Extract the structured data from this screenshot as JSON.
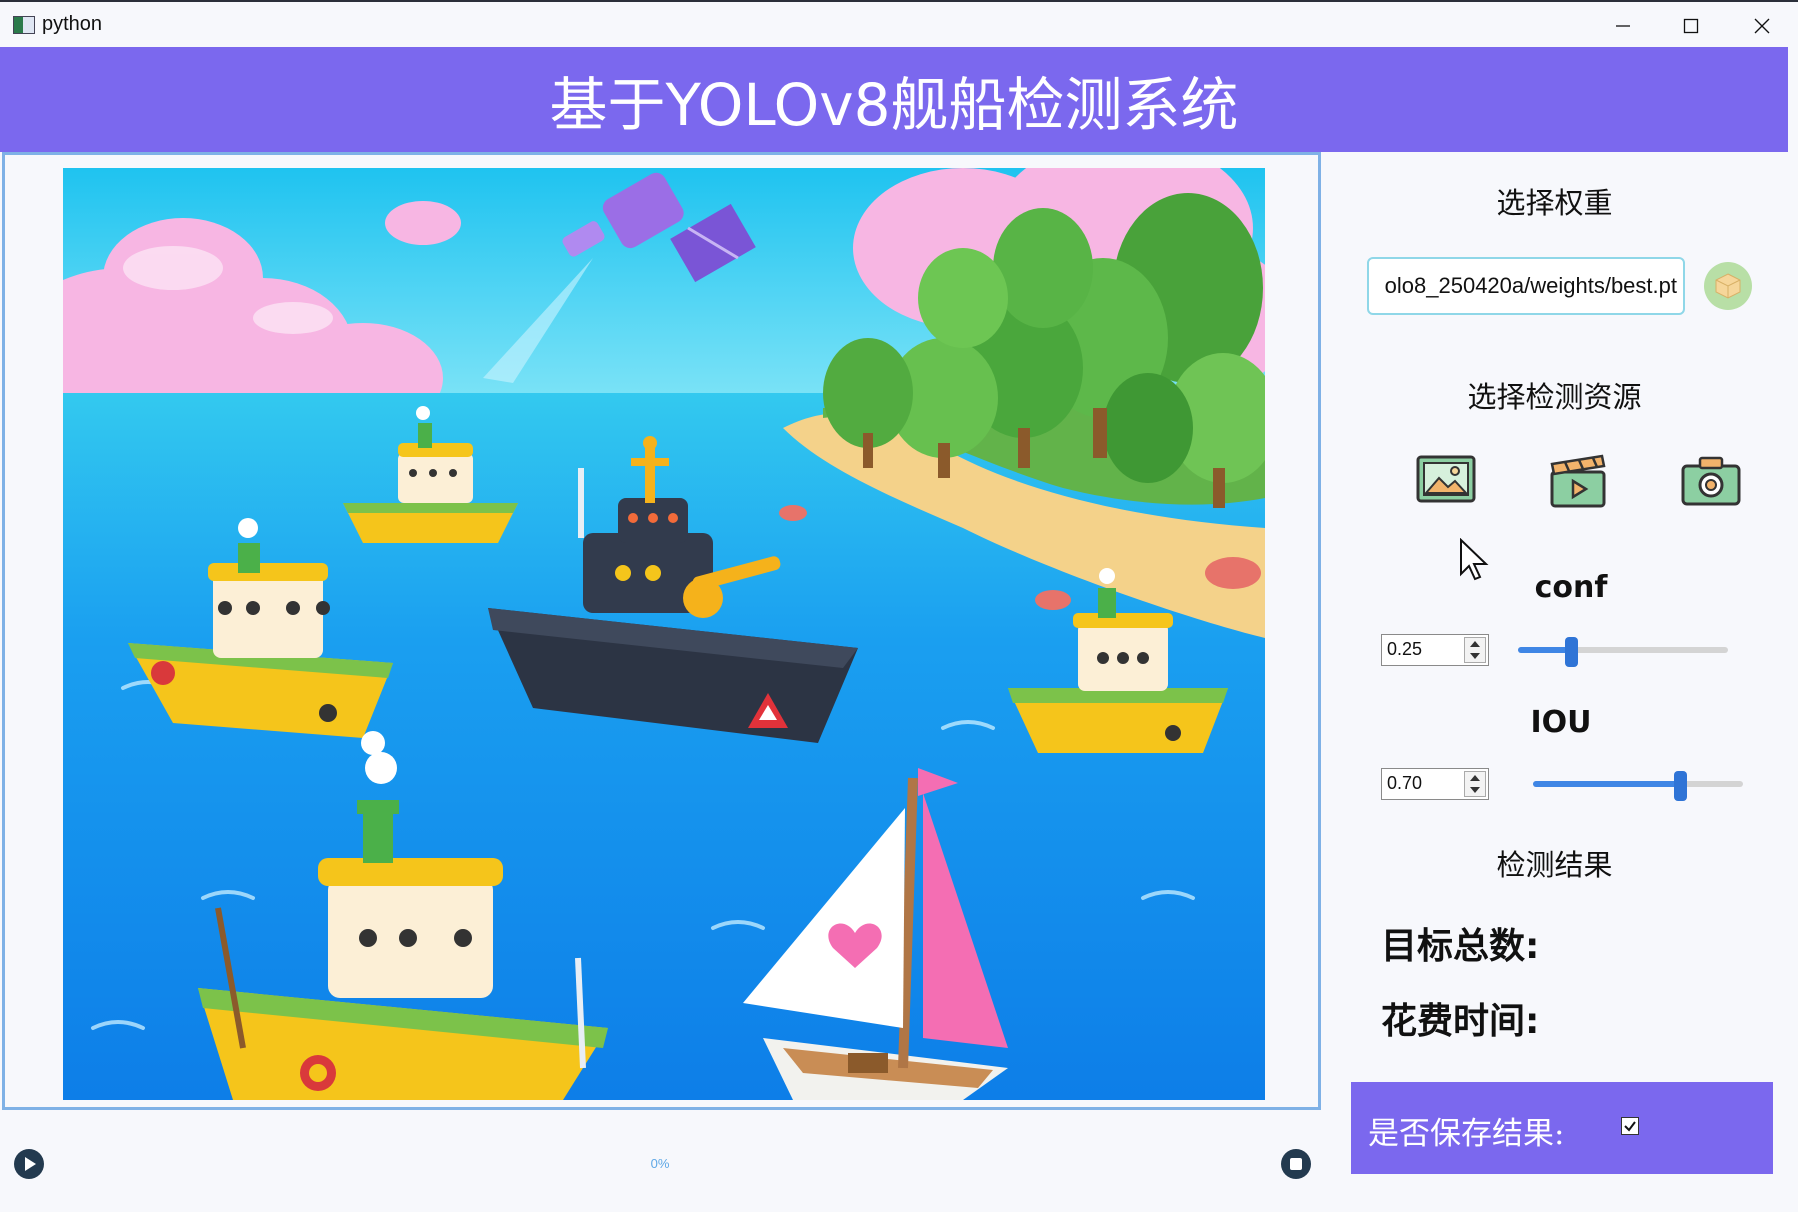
{
  "window": {
    "title": "python"
  },
  "header": {
    "title": "基于YOLOv8舰船检测系统"
  },
  "weights": {
    "section_title": "选择权重",
    "path_value": "olo8_250420a/weights/best.pt",
    "select_icon": "cube-icon"
  },
  "source": {
    "section_title": "选择检测资源",
    "icons": [
      "image-icon",
      "video-icon",
      "camera-icon"
    ]
  },
  "conf": {
    "label": "conf",
    "value": "0.25",
    "slider_fraction": 0.25
  },
  "iou": {
    "label": "IOU",
    "value": "0.70",
    "slider_fraction": 0.7
  },
  "results": {
    "section_title": "检测结果",
    "total_targets_label": "目标总数:",
    "time_spent_label": "花费时间:"
  },
  "save": {
    "label": "是否保存结果:",
    "checked": true
  },
  "playback": {
    "progress_text": "0%",
    "progress_fraction": 0
  },
  "colors": {
    "accent": "#7b68ee",
    "border": "#7fb1e6",
    "slider": "#3f86e5"
  }
}
